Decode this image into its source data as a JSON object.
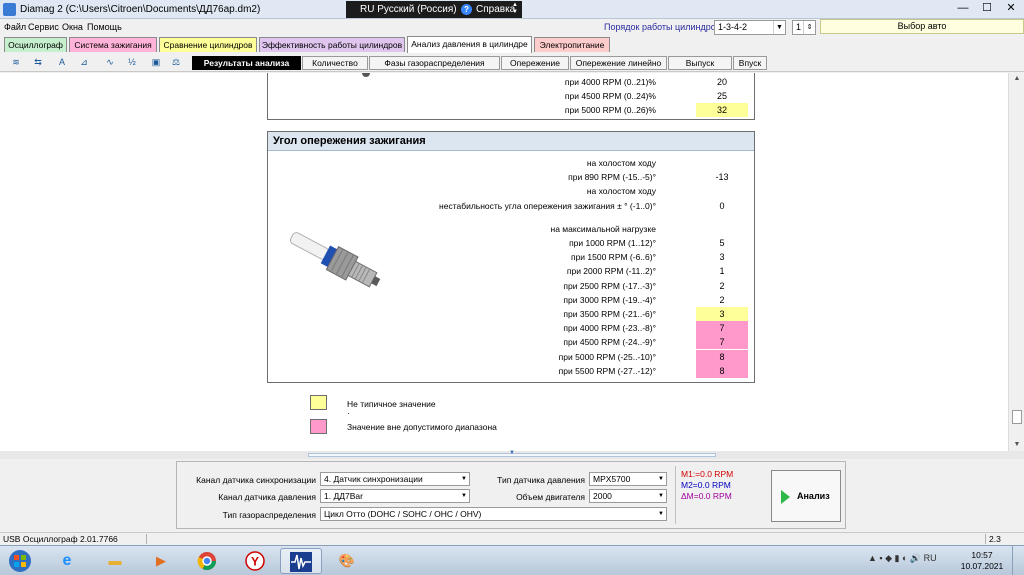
{
  "window": {
    "title": "Diamag 2 (C:\\Users\\Citroen\\Documents\\ДД76ар.dm2)",
    "lang_label": "RU Русский (Россия)",
    "help_label": "Справка",
    "minimize": "—",
    "maximize": "☐",
    "close": "✕"
  },
  "menu": {
    "items": [
      "Файл",
      "Сервис",
      "Окна",
      "Помощь"
    ],
    "cylinder_order_label": "Порядок работы цилиндров",
    "cylinder_order_value": "1-3-4-2",
    "cylinder_value": "1",
    "select_car": "Выбор авто"
  },
  "tabs": [
    {
      "label": "Осциллограф",
      "color": "#c6efce"
    },
    {
      "label": "Система зажигания",
      "color": "#ffb3d9"
    },
    {
      "label": "Сравнение цилиндров",
      "color": "#ffff99"
    },
    {
      "label": "Эффективность работы цилиндров",
      "color": "#e0c6ef"
    },
    {
      "label": "Анализ давления в цилиндре",
      "color": "#ffffff"
    },
    {
      "label": "Электропитание",
      "color": "#ffcccc"
    }
  ],
  "toolbar": {
    "icons": [
      "waveform-icon",
      "gear-scale-icon",
      "auto-icon",
      "chart-icon",
      "line-icon",
      "alg-icon",
      "save-icon",
      "scale-icon"
    ],
    "icon_glyphs": [
      "≋",
      "⇆",
      "A",
      "⊿",
      "∿",
      "½",
      "▣",
      "⚖"
    ],
    "subtabs": [
      "Результаты анализа",
      "Количество",
      "Фазы газораспределения",
      "Опережение",
      "Опережение линейно",
      "Выпуск",
      "Впуск"
    ]
  },
  "top_rows": [
    {
      "label": "при  4000 RPM (0..21)%",
      "value": "20",
      "status": "normal"
    },
    {
      "label": "при  4500 RPM (0..24)%",
      "value": "25",
      "status": "normal"
    },
    {
      "label": "при  5000 RPM (0..26)%",
      "value": "32",
      "status": "atypical"
    }
  ],
  "section": {
    "title": "Угол опережения зажигания",
    "rows": [
      {
        "label": "на холостом ходу",
        "value": ""
      },
      {
        "label": "при 890 RPM (-15..-5)°",
        "value": "-13",
        "status": "normal"
      },
      {
        "label": "на холостом ходу",
        "value": ""
      },
      {
        "label": "нестабильность угла опережения зажигания ± ° (-1..0)°",
        "value": "0",
        "status": "normal"
      },
      {
        "label": "на максимальной нагрузке",
        "value": ""
      },
      {
        "label": "при 1000 RPM (1..12)°",
        "value": "5",
        "status": "normal"
      },
      {
        "label": "при 1500 RPM (-6..6)°",
        "value": "3",
        "status": "normal"
      },
      {
        "label": "при 2000 RPM (-11..2)°",
        "value": "1",
        "status": "normal"
      },
      {
        "label": "при 2500 RPM (-17..-3)°",
        "value": "2",
        "status": "normal"
      },
      {
        "label": "при 3000 RPM (-19..-4)°",
        "value": "2",
        "status": "normal"
      },
      {
        "label": "при 3500 RPM (-21..-6)°",
        "value": "3",
        "status": "atypical"
      },
      {
        "label": "при 4000 RPM (-23..-8)°",
        "value": "7",
        "status": "out_of_range"
      },
      {
        "label": "при 4500 RPM (-24..-9)°",
        "value": "7",
        "status": "out_of_range"
      },
      {
        "label": "при 5000 RPM (-25..-10)°",
        "value": "8",
        "status": "out_of_range"
      },
      {
        "label": "при 5500 RPM (-27..-12)°",
        "value": "8",
        "status": "out_of_range"
      }
    ]
  },
  "legend": {
    "atypical": {
      "label": "Не типичное значение",
      "color": "#ffff99"
    },
    "dot": "·",
    "out_of_range": {
      "label": "Значение вне допустимого диапазона",
      "color": "#ff99cc"
    }
  },
  "panel": {
    "sync_label": "Канал датчика синхронизации",
    "sync_value": "4.  Датчик синхронизации",
    "pressure_ch_label": "Канал датчика давления",
    "pressure_ch_value": "1.  ДД7Bar",
    "timing_label": "Тип газораспределения",
    "timing_value": "Цикл Отто (DOHC / SOHC / OHC / OHV)",
    "sensor_type_label": "Тип датчика давления",
    "sensor_type_value": "MPX5700",
    "engine_volume_label": "Объем двигателя",
    "engine_volume_value": "2000",
    "m1": "M1:=0.0 RPM",
    "m2": "M2=0.0 RPM",
    "dm": "ΔM=0.0 RPM",
    "analyze": "Анализ"
  },
  "status": {
    "left": "USB Осциллограф   2.01.7766",
    "right": "2.3"
  },
  "taskbar": {
    "time": "10:57",
    "date": "10.07.2021"
  }
}
